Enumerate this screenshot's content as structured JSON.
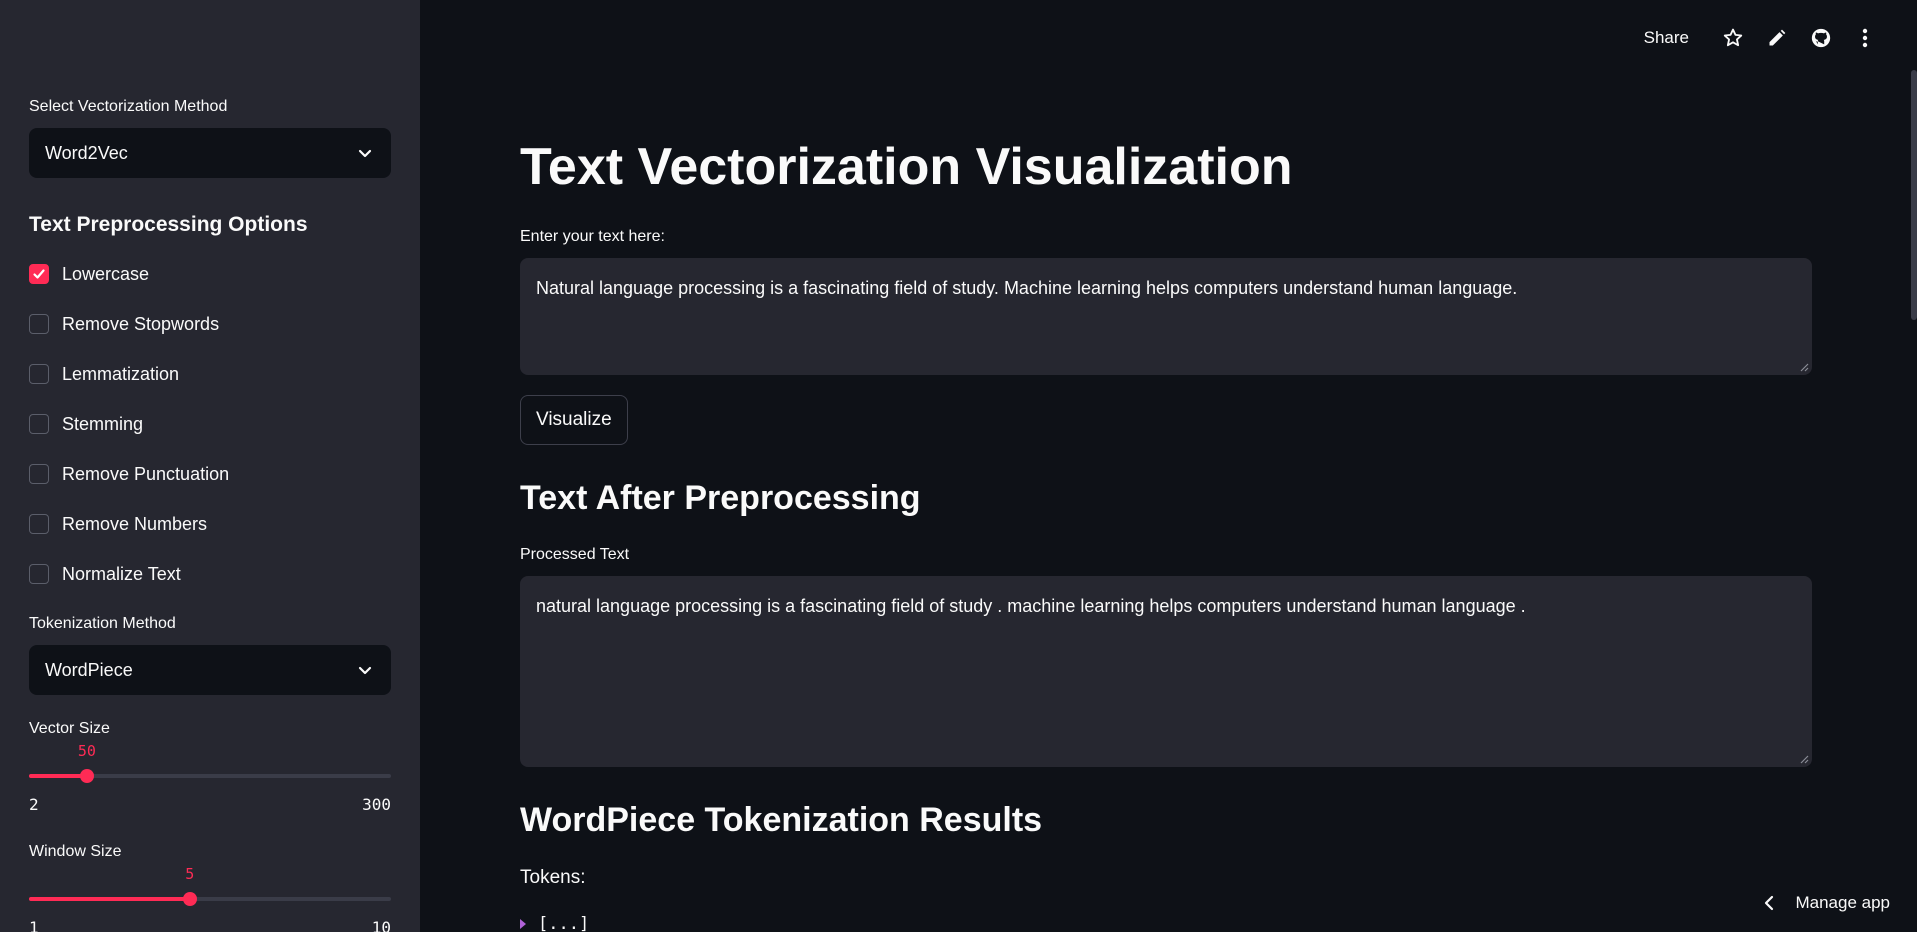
{
  "sidebar": {
    "vectorization_label": "Select Vectorization Method",
    "vectorization_value": "Word2Vec",
    "preprocessing_heading": "Text Preprocessing Options",
    "options": [
      {
        "label": "Lowercase",
        "checked": true
      },
      {
        "label": "Remove Stopwords",
        "checked": false
      },
      {
        "label": "Lemmatization",
        "checked": false
      },
      {
        "label": "Stemming",
        "checked": false
      },
      {
        "label": "Remove Punctuation",
        "checked": false
      },
      {
        "label": "Remove Numbers",
        "checked": false
      },
      {
        "label": "Normalize Text",
        "checked": false
      }
    ],
    "tokenization_label": "Tokenization Method",
    "tokenization_value": "WordPiece",
    "vector_size": {
      "label": "Vector Size",
      "value": "50",
      "min": "2",
      "max": "300",
      "fraction": 0.16
    },
    "window_size": {
      "label": "Window Size",
      "value": "5",
      "min": "1",
      "max": "10",
      "fraction": 0.444
    }
  },
  "topbar": {
    "share_label": "Share"
  },
  "main": {
    "title": "Text Vectorization Visualization",
    "input_label": "Enter your text here:",
    "input_value": "Natural language processing is a fascinating field of study. Machine learning helps computers understand human language.",
    "visualize_label": "Visualize",
    "preprocess_heading": "Text After Preprocessing",
    "processed_label": "Processed Text",
    "processed_value": "natural language processing is a fascinating field of study . machine learning helps computers understand human language .",
    "results_heading": "WordPiece Tokenization Results",
    "tokens_label": "Tokens:",
    "tokens_preview": "[...]"
  },
  "manage_app_label": "Manage app",
  "colors": {
    "accent": "#ff2b55",
    "sidebar_bg": "#262730",
    "main_bg": "#0e1117"
  }
}
